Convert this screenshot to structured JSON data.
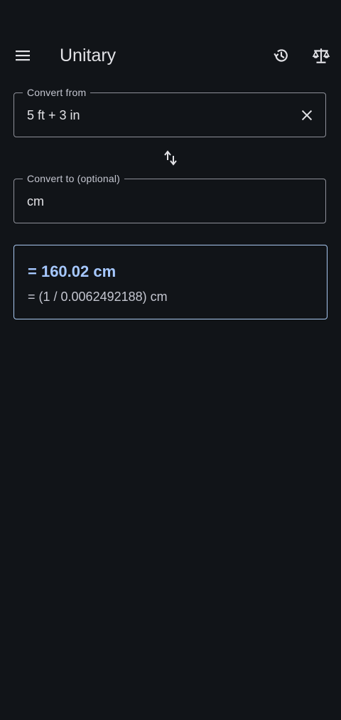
{
  "app_bar": {
    "title": "Unitary",
    "icons": [
      "menu-icon",
      "history-icon",
      "scale-balance-icon"
    ]
  },
  "convert_from": {
    "label": "Convert from",
    "value": "5 ft + 3 in",
    "clear_icon": "close-icon"
  },
  "swap": {
    "icon": "swap-vertical-icon"
  },
  "convert_to": {
    "label": "Convert to (optional)",
    "value": "cm"
  },
  "result": {
    "primary": "= 160.02 cm",
    "secondary": "= (1 / 0.0062492188) cm"
  },
  "colors": {
    "background": "#111418",
    "accent": "#a6c8ff",
    "outline": "#8e9099",
    "text": "#e2e2e6"
  }
}
